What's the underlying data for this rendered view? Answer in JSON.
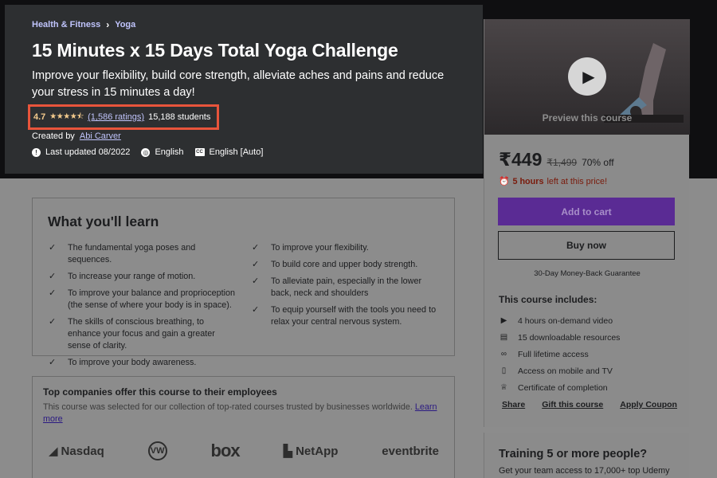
{
  "breadcrumb": {
    "category": "Health & Fitness",
    "subcategory": "Yoga"
  },
  "course": {
    "title": "15 Minutes x 15 Days Total Yoga Challenge",
    "subtitle": "Improve your flexibility, build core strength, alleviate aches and pains and reduce your stress in 15 minutes a day!",
    "rating": "4.7",
    "stars": "★★★★⯪",
    "ratings_count": "(1,586 ratings)",
    "students": "15,188 students",
    "created_by_label": "Created by",
    "author": "Abi Carver",
    "last_updated": "Last updated 08/2022",
    "language": "English",
    "captions": "English [Auto]"
  },
  "learn": {
    "heading": "What you'll learn",
    "left": [
      "The fundamental yoga poses and sequences.",
      "To increase your range of motion.",
      "To improve your balance and proprioception (the sense of where your body is in space).",
      "The skills of conscious breathing, to enhance your focus and gain a greater sense of clarity.",
      "To improve your body awareness."
    ],
    "right": [
      "To improve your flexibility.",
      "To build core and upper body strength.",
      "To alleviate pain, especially in the lower back, neck and shoulders",
      "To equip yourself with the tools you need to relax your central nervous system."
    ]
  },
  "companies": {
    "heading": "Top companies offer this course to their employees",
    "text": "This course was selected for our collection of top-rated courses trusted by businesses worldwide.",
    "learn_more": "Learn more",
    "logos": [
      "Nasdaq",
      "VW",
      "box",
      "NetApp",
      "eventbrite"
    ]
  },
  "sidebar": {
    "preview_label": "Preview this course",
    "price": "₹449",
    "old_price": "₹1,499",
    "discount": "70% off",
    "timer_bold": "5 hours",
    "timer_rest": "left at this price!",
    "add_to_cart": "Add to cart",
    "buy_now": "Buy now",
    "guarantee": "30-Day Money-Back Guarantee",
    "includes_heading": "This course includes:",
    "includes": [
      {
        "icon": "video-icon",
        "glyph": "▶",
        "text": "4 hours on-demand video"
      },
      {
        "icon": "file-icon",
        "glyph": "▤",
        "text": "15 downloadable resources"
      },
      {
        "icon": "infinity-icon",
        "glyph": "∞",
        "text": "Full lifetime access"
      },
      {
        "icon": "mobile-icon",
        "glyph": "▯",
        "text": "Access on mobile and TV"
      },
      {
        "icon": "trophy-icon",
        "glyph": "♕",
        "text": "Certificate of completion"
      }
    ],
    "actions": [
      "Share",
      "Gift this course",
      "Apply Coupon"
    ]
  },
  "training": {
    "heading": "Training 5 or more people?",
    "text": "Get your team access to 17,000+ top Udemy"
  },
  "colors": {
    "hero_bg": "#2d2f31",
    "accent_purple": "#5a2b94",
    "link_purple": "#c0c4fc",
    "star_gold": "#f3ca8c",
    "highlight_border": "#e8543b"
  }
}
